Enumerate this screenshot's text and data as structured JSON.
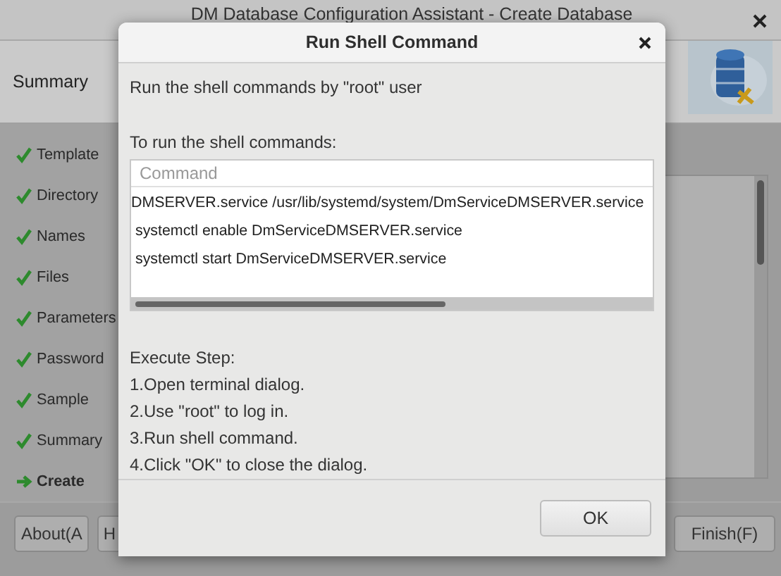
{
  "main_window": {
    "title": "DM Database Configuration Assistant - Create Database",
    "header": "Summary",
    "steps": [
      {
        "label": "Template",
        "current": false
      },
      {
        "label": "Directory",
        "current": false
      },
      {
        "label": "Names",
        "current": false
      },
      {
        "label": "Files",
        "current": false
      },
      {
        "label": "Parameters",
        "current": false
      },
      {
        "label": "Password",
        "current": false
      },
      {
        "label": "Sample",
        "current": false
      },
      {
        "label": "Summary",
        "current": false
      },
      {
        "label": "Create",
        "current": true
      }
    ],
    "buttons": [
      "About(A",
      "H",
      "Finish(F)"
    ]
  },
  "dialog": {
    "title": "Run Shell Command",
    "intro": "Run the shell commands by \"root\" user",
    "commands_label": "To run the shell commands:",
    "table": {
      "columns": [
        "Command"
      ],
      "rows": [
        "DMSERVER.service /usr/lib/systemd/system/DmServiceDMSERVER.service",
        " systemctl enable DmServiceDMSERVER.service",
        " systemctl start DmServiceDMSERVER.service"
      ]
    },
    "steps_title": "Execute Step:",
    "steps": [
      "1.Open terminal dialog.",
      "2.Use \"root\" to log in.",
      "3.Run shell command.",
      "4.Click \"OK\" to close the dialog."
    ],
    "buttons": [
      "OK"
    ]
  }
}
